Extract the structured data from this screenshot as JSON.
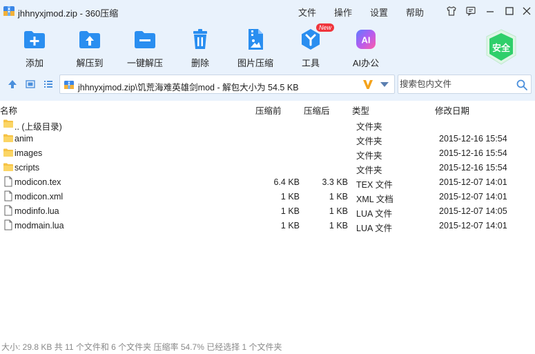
{
  "window": {
    "title": "jhhnyxjmod.zip - 360压缩"
  },
  "menu": {
    "file": "文件",
    "operate": "操作",
    "settings": "设置",
    "help": "帮助"
  },
  "toolbar": {
    "items": [
      {
        "label": "添加",
        "icon": "add-icon"
      },
      {
        "label": "解压到",
        "icon": "extract-to-icon"
      },
      {
        "label": "一键解压",
        "icon": "one-click-extract-icon"
      },
      {
        "label": "删除",
        "icon": "delete-icon"
      },
      {
        "label": "图片压缩",
        "icon": "image-compress-icon"
      },
      {
        "label": "工具",
        "icon": "tools-icon"
      },
      {
        "label": "AI办公",
        "icon": "ai-office-icon"
      }
    ],
    "new_badge": "New",
    "safe_label": "安全"
  },
  "address": {
    "path": "jhhnyxjmod.zip\\饥荒海难英雄剑mod - 解包大小为 54.5 KB"
  },
  "search": {
    "placeholder": "搜索包内文件"
  },
  "columns": {
    "name": "名称",
    "packed": "压缩前",
    "size": "压缩后",
    "type": "类型",
    "modified": "修改日期"
  },
  "files": [
    {
      "name": ".. (上级目录)",
      "packed": "",
      "size": "",
      "type": "文件夹",
      "modified": "",
      "kind": "folder"
    },
    {
      "name": "anim",
      "packed": "",
      "size": "",
      "type": "文件夹",
      "modified": "2015-12-16 15:54",
      "kind": "folder"
    },
    {
      "name": "images",
      "packed": "",
      "size": "",
      "type": "文件夹",
      "modified": "2015-12-16 15:54",
      "kind": "folder"
    },
    {
      "name": "scripts",
      "packed": "",
      "size": "",
      "type": "文件夹",
      "modified": "2015-12-16 15:54",
      "kind": "folder"
    },
    {
      "name": "modicon.tex",
      "packed": "6.4 KB",
      "size": "3.3 KB",
      "type": "TEX 文件",
      "modified": "2015-12-07 14:01",
      "kind": "file"
    },
    {
      "name": "modicon.xml",
      "packed": "1 KB",
      "size": "1 KB",
      "type": "XML 文档",
      "modified": "2015-12-07 14:01",
      "kind": "file"
    },
    {
      "name": "modinfo.lua",
      "packed": "1 KB",
      "size": "1 KB",
      "type": "LUA 文件",
      "modified": "2015-12-07 14:05",
      "kind": "file"
    },
    {
      "name": "modmain.lua",
      "packed": "1 KB",
      "size": "1 KB",
      "type": "LUA 文件",
      "modified": "2015-12-07 14:01",
      "kind": "file"
    }
  ],
  "status": {
    "text": "大小: 29.8 KB 共 11 个文件和 6 个文件夹 压缩率 54.7% 已经选择 1 个文件夹"
  },
  "colors": {
    "toolbar_bg": "#e9f2fc",
    "icon_blue": "#2a8ef0",
    "safe_green": "#2fcf6a",
    "badge_red": "#f0353c",
    "folder_yellow": "#f6c244"
  }
}
